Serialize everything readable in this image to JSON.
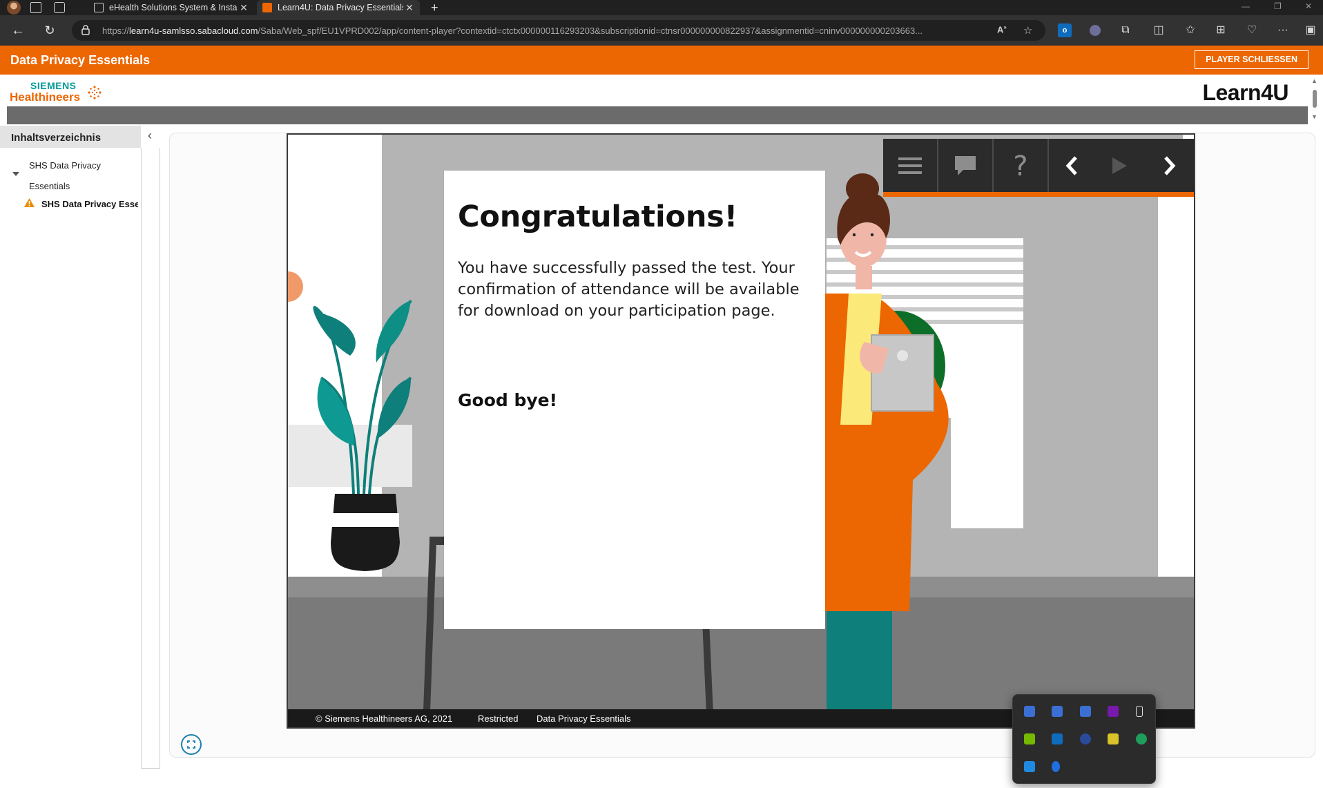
{
  "browser": {
    "tabs": [
      {
        "label": "eHealth Solutions System & Insta"
      },
      {
        "label": "Learn4U: Data Privacy Essentials",
        "active": true
      }
    ],
    "url_prefix": "https://",
    "url_host": "learn4u-samlsso.sabacloud.com",
    "url_path": "/Saba/Web_spf/EU1VPRD002/app/content-player?contextid=ctctx000000116293203&subscriptionid=ctnsr000000000822937&assignmentid=cninv000000000203663...",
    "new_tab_symbol": "+"
  },
  "app": {
    "title": "Data Privacy Essentials",
    "close_player_label": "PLAYER SCHLIESSEN",
    "brand_siemens": "SIEMENS",
    "brand_healthineers": "Healthineers",
    "brand_learn4u": "Learn4U"
  },
  "sidebar": {
    "heading": "Inhaltsverzeichnis",
    "collapse_symbol": "‹",
    "tree": {
      "parent_label": "SHS Data Privacy Essentials",
      "child_label": "SHS Data Privacy Esse",
      "child_status": "warning"
    }
  },
  "slide": {
    "heading": "Congratulations!",
    "body": "You have successfully passed the test. Your confirmation of attendance will be available for download on your participation page.",
    "farewell": "Good bye!",
    "footer": {
      "copyright": "© Siemens Healthineers AG, 2021",
      "classification": "Restricted",
      "course": "Data Privacy Essentials"
    },
    "controls": [
      "menu-icon",
      "comment-icon",
      "help-icon",
      "previous-icon",
      "play-icon",
      "next-icon"
    ]
  },
  "colors": {
    "accent": "#ec6602",
    "teal": "#009999",
    "toolbar": "#2b2b2b"
  }
}
